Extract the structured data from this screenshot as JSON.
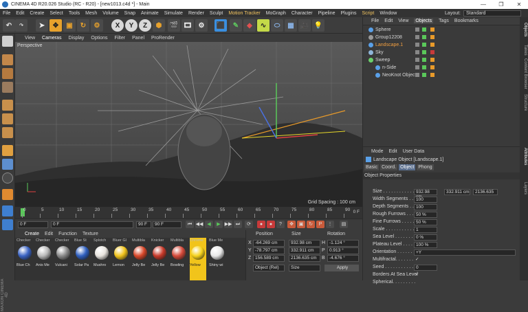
{
  "window": {
    "title": "CINEMA 4D R20.026 Studio (RC - R20) - [new1013.c4d *] - Main"
  },
  "menu": [
    "File",
    "Edit",
    "Create",
    "Select",
    "Tools",
    "Mesh",
    "Volume",
    "Snap",
    "Animate",
    "Simulate",
    "Render",
    "Sculpt",
    "Motion Tracker",
    "MoGraph",
    "Character",
    "Pipeline",
    "Plugins",
    "Script",
    "Window"
  ],
  "menu_highlight": [
    "Motion Tracker",
    "Script"
  ],
  "layout": {
    "label": "Layout:",
    "value": "Standard"
  },
  "toolbar": {
    "axis_x": "X",
    "axis_y": "Y",
    "axis_z": "Z"
  },
  "viewport": {
    "menu": [
      "View",
      "Cameras",
      "Display",
      "Options",
      "Filter",
      "Panel",
      "ProRender"
    ],
    "active_menu": "Cameras",
    "label": "Perspective",
    "grid_spacing": "Grid Spacing : 100 cm"
  },
  "timeline": {
    "ticks": [
      "0",
      "5",
      "10",
      "15",
      "20",
      "25",
      "30",
      "35",
      "40",
      "45",
      "50",
      "55",
      "60",
      "65",
      "70",
      "75",
      "80",
      "85",
      "90"
    ],
    "current_frame": "0 F",
    "end_label": "0 F"
  },
  "transport": {
    "start": "0 F",
    "current": "0 F",
    "end_a": "90 F",
    "end_b": "90 F"
  },
  "materials": {
    "tabs": [
      "Create",
      "Edit",
      "Function",
      "Texture"
    ],
    "items": [
      {
        "top": "Checker",
        "name": "Blue Ch",
        "color": "#3b64c4"
      },
      {
        "top": "Checker",
        "name": "Anis Me",
        "color": "#b9b9b9"
      },
      {
        "top": "Checker",
        "name": "Vulcani",
        "color": "#8a8a8a"
      },
      {
        "top": "Blue St",
        "name": "Solar Pa",
        "color": "#2f5fbf"
      },
      {
        "top": "Splotch",
        "name": "Mushro",
        "color": "#e8e4de"
      },
      {
        "top": "Bluer Gl",
        "name": "Lemon",
        "color": "#f1c41b"
      },
      {
        "top": "Multibla",
        "name": "Jelly Be",
        "color": "#d9482a"
      },
      {
        "top": "Knicker",
        "name": "Jelly Be",
        "color": "#c93a2a"
      },
      {
        "top": "Multibla",
        "name": "Bowling",
        "color": "#d64a3a"
      },
      {
        "top": "Chrome",
        "name": "Yellow",
        "color": "#f5d21c",
        "selected": true
      },
      {
        "top": "Blue Me",
        "name": "Shiny wi",
        "color": "#e8e8e8"
      }
    ]
  },
  "coordinates": {
    "headers": [
      "Position",
      "Size",
      "Rotation"
    ],
    "rows": [
      {
        "axis": "X",
        "pos": "-64.269 cm",
        "size": "932.98 cm",
        "rot_axis": "H",
        "rot": "-1.124 °"
      },
      {
        "axis": "Y",
        "pos": "-78.797 cm",
        "size": "332.911 cm",
        "rot_axis": "P",
        "rot": "0.913 °"
      },
      {
        "axis": "Z",
        "pos": "156.589 cm",
        "size": "2136.635 cm",
        "rot_axis": "B",
        "rot": "-4.676 °"
      }
    ],
    "mode": "Object (Rel)",
    "size_mode": "Size",
    "apply": "Apply"
  },
  "objects": {
    "tabs": [
      "File",
      "Edit",
      "View",
      "Objects",
      "Tags",
      "Bookmarks"
    ],
    "active_tab": "Objects",
    "items": [
      {
        "name": "Sphere",
        "indent": 0,
        "icon_color": "#5aa0e8",
        "orange": false
      },
      {
        "name": "Group12208",
        "indent": 0,
        "icon_color": "#9a9a9a",
        "orange": false
      },
      {
        "name": "Landscape.1",
        "indent": 0,
        "icon_color": "#5aa0e8",
        "orange": true
      },
      {
        "name": "Sky",
        "indent": 0,
        "icon_color": "#8fb5d8",
        "orange": false
      },
      {
        "name": "Sweep",
        "indent": 0,
        "icon_color": "#6bd06b",
        "orange": false
      },
      {
        "name": "n-Side",
        "indent": 1,
        "icon_color": "#5aa0e8",
        "orange": false
      },
      {
        "name": "NeoKnot Object",
        "indent": 1,
        "icon_color": "#5aa0e8",
        "orange": false
      }
    ]
  },
  "attributes": {
    "menu": [
      "Mode",
      "Edit",
      "User Data"
    ],
    "title": "Landscape Object [Landscape.1]",
    "tabs": [
      "Basic",
      "Coord.",
      "Object",
      "Phong"
    ],
    "active_tab": "Object",
    "section": "Object Properties",
    "rows": [
      {
        "label": "Size . . . . . . . . . . . . .",
        "v1": "932.98 cm",
        "v2": "332.911 cm",
        "v3": "2136.635"
      },
      {
        "label": "Width Segments . . .",
        "v1": "100"
      },
      {
        "label": "Depth Segments . . .",
        "v1": "100"
      },
      {
        "label": "Rough Furrows . . . .",
        "v1": "50 %"
      },
      {
        "label": "Fine Furrows . . . . .",
        "v1": "50 %"
      },
      {
        "label": "Scale . . . . . . . . . . . .",
        "v1": "1"
      },
      {
        "label": "Sea Level . . . . . . . .",
        "v1": "0 %"
      },
      {
        "label": "Plateau Level . . . . .",
        "v1": "100 %"
      },
      {
        "label": "Orientation . . . . . . .",
        "v1": "+Y"
      },
      {
        "label": "Multifractal. . . . . . .",
        "v1": "✓"
      },
      {
        "label": "Seed . . . . . . . . . . . .",
        "v1": "0"
      },
      {
        "label": "Borders At Sea Level",
        "v1": "✓"
      },
      {
        "label": "Spherical. . . . . . . . .",
        "v1": ""
      }
    ]
  },
  "side_tabs": [
    "Objects",
    "Takes",
    "Content Browser",
    "Structure",
    "Attributes",
    "Layers"
  ],
  "logo": "MAXON CINEMA 4D"
}
